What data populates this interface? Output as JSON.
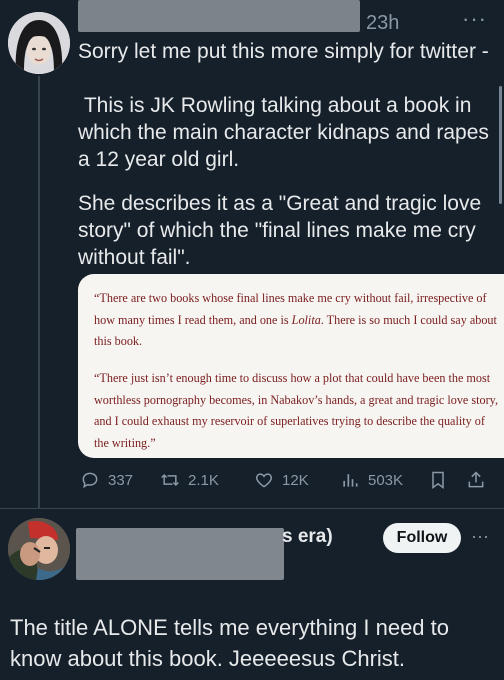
{
  "tweet": {
    "time": "23h",
    "more": "···",
    "paragraphs": [
      "Sorry let me put this more simply for twitter -",
      " This is JK Rowling talking about a book in which the main character kidnaps and rapes a 12 year old girl.",
      "She describes it as a \"Great and tragic love story\" of which the \"final lines make me cry without fail\"."
    ],
    "quote": {
      "part1_a": "“There are two books whose final lines make me cry without fail, irrespective of how many times I read them, and one is ",
      "part1_italic": "Lolita",
      "part1_b": ". There is so much I could say about this book.",
      "part2": "“There just isn’t enough time to discuss how a plot that could have been the most worthless pornography becomes, in Nabakov’s hands, a great and tragic love story, and I could exhaust my reservoir of superlatives trying to describe the quality of the writing.”"
    },
    "stats": {
      "replies": "337",
      "retweets": "2.1K",
      "likes": "12K",
      "views": "503K"
    }
  },
  "reply": {
    "name_tail": "s era)",
    "follow_label": "Follow",
    "more": "···",
    "text": "The title ALONE tells me everything I need to know about this book. Jeeeeesus Christ."
  },
  "colors": {
    "background": "#15202b",
    "text": "#e7e9ea",
    "muted": "#8b98a5",
    "quote_text": "#7a1d1d"
  }
}
